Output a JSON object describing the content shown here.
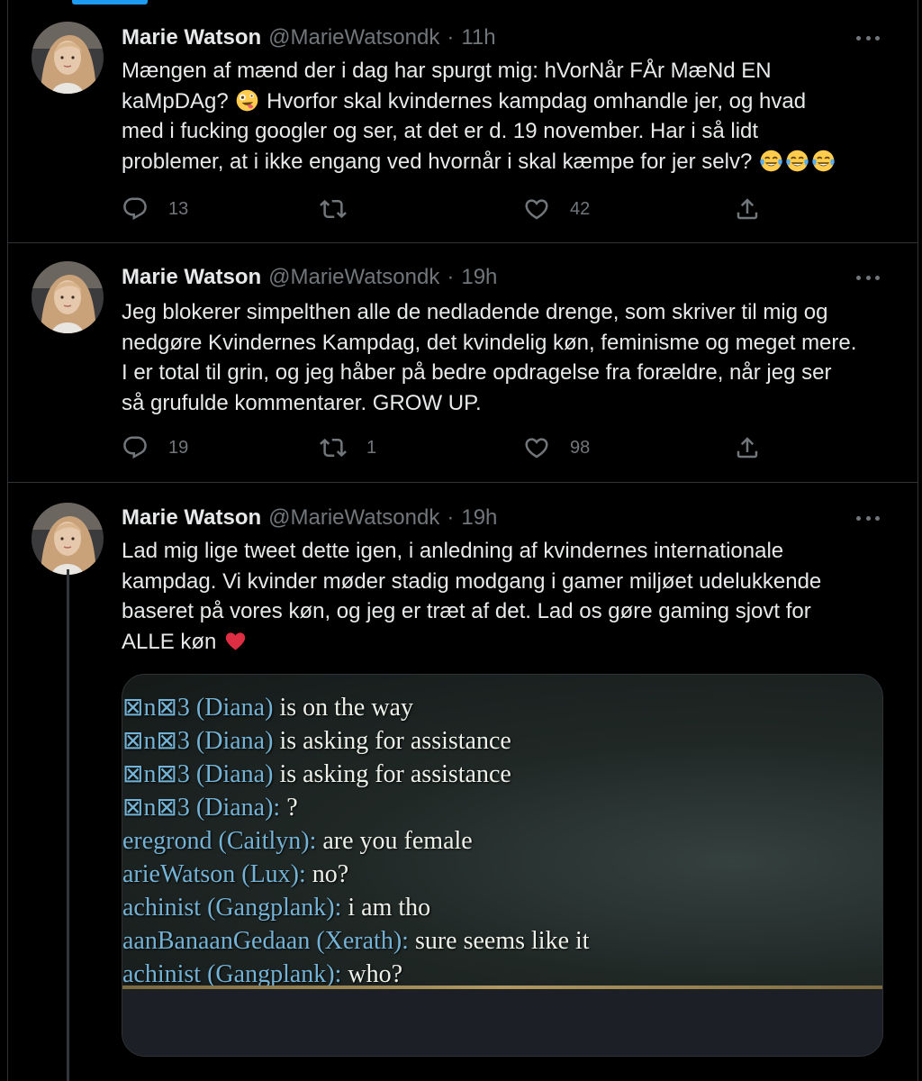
{
  "author": {
    "name": "Marie Watson",
    "handle": "@MarieWatsondk"
  },
  "separator": "·",
  "tweets": [
    {
      "time": "11h",
      "text_a": "Mængen af mænd der i dag har spurgt mig: hVorNår FÅr MæNd EN\nkaMpDAg?",
      "text_b": " Hvorfor skal kvindernes kampdag omhandle jer, og hvad\nmed i fucking googler og ser, at det er d. 19 november. Har i så lidt\nproblemer, at i ikke engang ved hvornår i skal kæmpe for jer selv? ",
      "emojis": [
        "zany-face-emoji",
        "tears-of-joy-emoji",
        "tears-of-joy-emoji",
        "tears-of-joy-emoji"
      ],
      "replies": "13",
      "retweets": "",
      "likes": "42"
    },
    {
      "time": "19h",
      "text": "Jeg blokerer simpelthen alle de nedladende drenge, som skriver til mig og\nnedgøre Kvindernes Kampdag, det kvindelig køn, feminisme og meget mere.\nI er total til grin, og jeg håber på bedre opdragelse fra forældre, når jeg ser\nså grufulde kommentarer. GROW UP.",
      "replies": "19",
      "retweets": "1",
      "likes": "98"
    },
    {
      "time": "19h",
      "text": "Lad mig lige tweet dette igen, i anledning af kvindernes internationale\nkampdag. Vi kvinder møder stadig modgang i gamer miljøet udelukkende\nbaseret på vores køn, og jeg er træt af det. Lad os gøre gaming sjovt for\nALLE køn ",
      "emoji": "red-heart-emoji",
      "image": {
        "chat": [
          {
            "name": "⊠n⊠3 (Diana)",
            "msg": " is on the way"
          },
          {
            "name": "⊠n⊠3 (Diana)",
            "msg": " is asking for assistance"
          },
          {
            "name": "⊠n⊠3 (Diana)",
            "msg": " is asking for assistance"
          },
          {
            "name": "⊠n⊠3 (Diana):",
            "msg": " ?"
          },
          {
            "name": "eregrond (Caitlyn):",
            "msg": " are you female"
          },
          {
            "name": "arieWatson (Lux):",
            "msg": " no?"
          },
          {
            "name": "achinist (Gangplank):",
            "msg": " i am tho"
          },
          {
            "name": "aanBanaanGedaan (Xerath):",
            "msg": " sure seems like it"
          },
          {
            "name": "achinist (Gangplank):",
            "msg": " who?"
          }
        ]
      }
    }
  ],
  "icons": {
    "reply": "reply-icon",
    "retweet": "retweet-icon",
    "like": "heart-icon",
    "share": "share-icon",
    "more": "more-icon"
  },
  "colors": {
    "background": "#000000",
    "text": "#e7e9ea",
    "secondary": "#71767b",
    "border": "#2f3336",
    "accent": "#1d9bf0",
    "chat_name": "#74b3d6"
  }
}
